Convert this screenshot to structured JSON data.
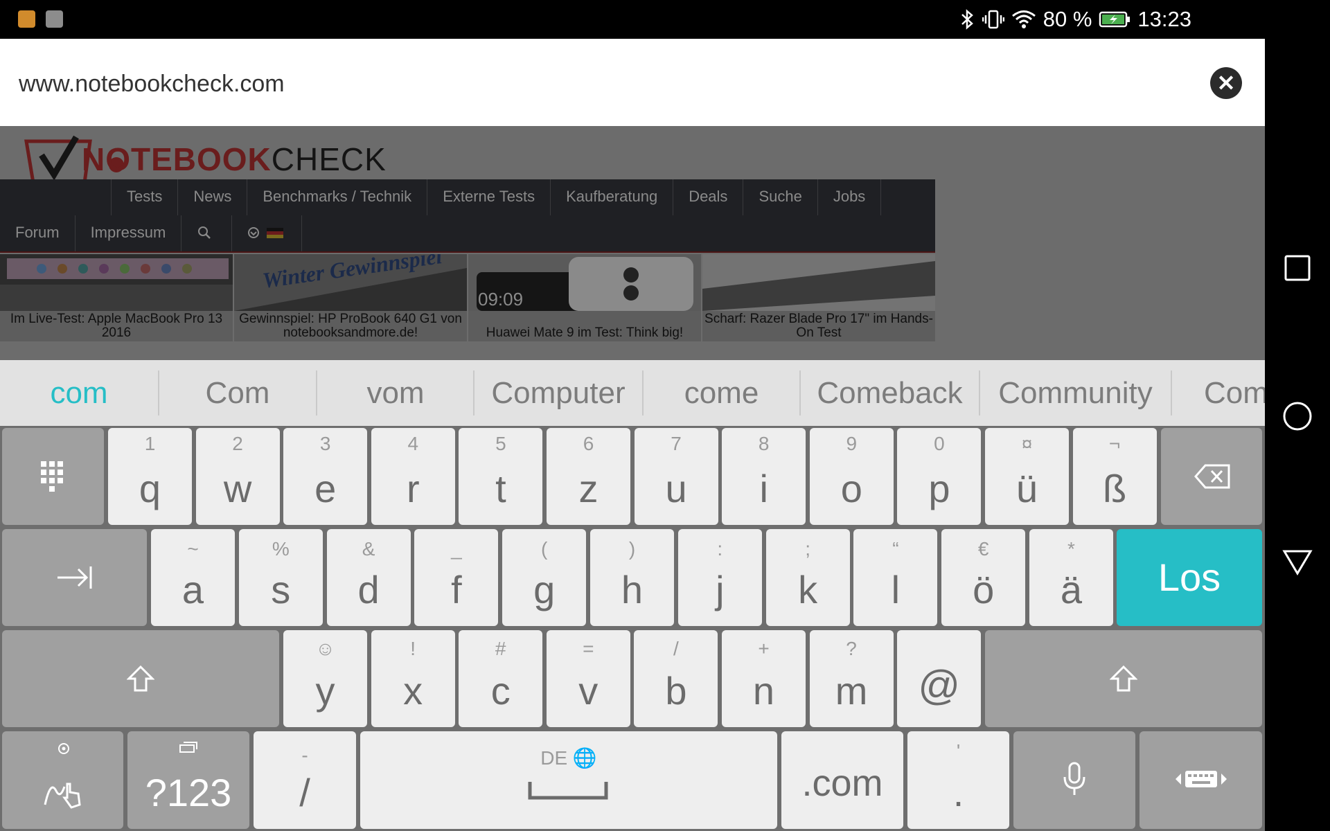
{
  "status_bar": {
    "battery_percent": "80 %",
    "time": "13:23",
    "icons": [
      "notification-app-icon",
      "gallery-icon",
      "bluetooth-icon",
      "vibrate-icon",
      "wifi-icon",
      "battery-charging-icon"
    ]
  },
  "url_bar": {
    "url": "www.notebookcheck.com",
    "clear_icon": "close-icon"
  },
  "webpage": {
    "logo_red": "NOTEBOOK",
    "logo_black": "CHECK",
    "nav_row1": [
      "Tests",
      "News",
      "Benchmarks / Technik",
      "Externe Tests",
      "Kaufberatung",
      "Deals",
      "Suche",
      "Jobs"
    ],
    "nav_row2": [
      "Forum",
      "Impressum"
    ],
    "articles": [
      {
        "caption": "Im Live-Test: Apple MacBook Pro 13 2016"
      },
      {
        "caption": "Gewinnspiel: HP ProBook 640 G1 von notebooksandmore.de!",
        "thumb_text": "Winter Gewinnspiel"
      },
      {
        "caption": "Huawei Mate 9 im Test: Think big!",
        "thumb_text": "09:09"
      },
      {
        "caption": "Scharf: Razer Blade Pro 17\" im Hands-On Test"
      }
    ]
  },
  "keyboard": {
    "suggestions": [
      "com",
      "Com",
      "vom",
      "Computer",
      "come",
      "Comeback",
      "Community",
      "Com"
    ],
    "accent_color": "#26bec6",
    "row1": [
      {
        "hint": "1",
        "label": "q"
      },
      {
        "hint": "2",
        "label": "w"
      },
      {
        "hint": "3",
        "label": "e"
      },
      {
        "hint": "4",
        "label": "r"
      },
      {
        "hint": "5",
        "label": "t"
      },
      {
        "hint": "6",
        "label": "z"
      },
      {
        "hint": "7",
        "label": "u"
      },
      {
        "hint": "8",
        "label": "i"
      },
      {
        "hint": "9",
        "label": "o"
      },
      {
        "hint": "0",
        "label": "p"
      },
      {
        "hint": "¤",
        "label": "ü"
      },
      {
        "hint": "¬",
        "label": "ß"
      }
    ],
    "row2": [
      {
        "hint": "~",
        "label": "a"
      },
      {
        "hint": "%",
        "label": "s"
      },
      {
        "hint": "&",
        "label": "d"
      },
      {
        "hint": "_",
        "label": "f"
      },
      {
        "hint": "(",
        "label": "g"
      },
      {
        "hint": ")",
        "label": "h"
      },
      {
        "hint": ":",
        "label": "j"
      },
      {
        "hint": ";",
        "label": "k"
      },
      {
        "hint": "“",
        "label": "l"
      },
      {
        "hint": "€",
        "label": "ö"
      },
      {
        "hint": "*",
        "label": "ä"
      }
    ],
    "row3": [
      {
        "hint": "☺",
        "label": "y"
      },
      {
        "hint": "!",
        "label": "x"
      },
      {
        "hint": "#",
        "label": "c"
      },
      {
        "hint": "=",
        "label": "v"
      },
      {
        "hint": "/",
        "label": "b"
      },
      {
        "hint": "+",
        "label": "n"
      },
      {
        "hint": "?",
        "label": "m"
      },
      {
        "hint": "",
        "label": "@"
      }
    ],
    "action_label": "Los",
    "symbols_label": "?123",
    "slash_hint": "-",
    "slash_label": "/",
    "space_hint": "DE",
    "dotcom_label": ".com",
    "period_hint": "'",
    "period_label": "."
  }
}
